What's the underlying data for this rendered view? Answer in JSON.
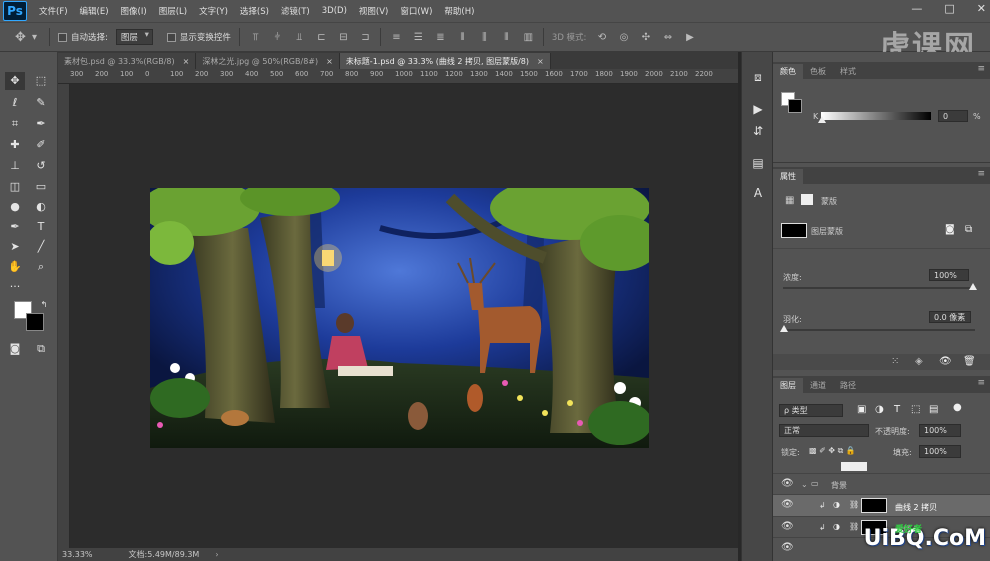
{
  "app": {
    "logo": "Ps"
  },
  "menu": [
    "文件(F)",
    "编辑(E)",
    "图像(I)",
    "图层(L)",
    "文字(Y)",
    "选择(S)",
    "滤镜(T)",
    "3D(D)",
    "视图(V)",
    "窗口(W)",
    "帮助(H)"
  ],
  "window_controls": {
    "minimize": "—",
    "maximize": "□",
    "close": "✕"
  },
  "options": {
    "auto_select_label": "自动选择:",
    "auto_select_value": "图层",
    "show_transform_label": "显示变换控件",
    "mode_label": "3D 模式:"
  },
  "tabs": [
    {
      "label": "素材包.psd @ 33.3%(RGB/8)",
      "close": "×",
      "active": false
    },
    {
      "label": "深林之光.jpg @ 50%(RGB/8#)",
      "close": "×",
      "active": false
    },
    {
      "label": "未标题-1.psd @ 33.3% (曲线 2 拷贝, 图层蒙版/8)",
      "close": "×",
      "active": true
    }
  ],
  "ruler_ticks": [
    "300",
    "200",
    "100",
    "0",
    "100",
    "200",
    "300",
    "400",
    "500",
    "600",
    "700",
    "800",
    "900",
    "1000",
    "1100",
    "1200",
    "1300",
    "1400",
    "1500",
    "1600",
    "1700",
    "1800",
    "1900",
    "2000",
    "2100",
    "2200"
  ],
  "status": {
    "zoom": "33.33%",
    "doc": "文档:5.49M/89.3M"
  },
  "color_panel": {
    "tabs": [
      "颜色",
      "色板",
      "样式"
    ],
    "channel": "K",
    "value": "0",
    "unit": "%"
  },
  "properties_panel": {
    "title": "属性",
    "mask_label": "蒙版",
    "layer_mask_label": "图层蒙版",
    "density_label": "浓度:",
    "density_value": "100%",
    "feather_label": "羽化:",
    "feather_value": "0.0 像素"
  },
  "layers_panel": {
    "tabs": [
      "图层",
      "通道",
      "路径"
    ],
    "filter_label": "ρ 类型",
    "blend_mode": "正常",
    "opacity_label": "不透明度:",
    "opacity_value": "100%",
    "lock_label": "锁定:",
    "fill_label": "填充:",
    "fill_value": "100%",
    "layers": [
      {
        "name": "背景",
        "type": "group"
      },
      {
        "name": "曲线 2 拷贝",
        "type": "adjustment"
      },
      {
        "name": "曲线 2",
        "type": "adjustment"
      }
    ]
  },
  "watermarks": {
    "top": "虎课网",
    "bottom": "UiBQ.CoM",
    "bottom_small": "爱好者"
  },
  "colors": {
    "ps_blue": "#31a8ff",
    "ui_dark": "#535353",
    "canvas_bg": "#2c2c2c"
  }
}
